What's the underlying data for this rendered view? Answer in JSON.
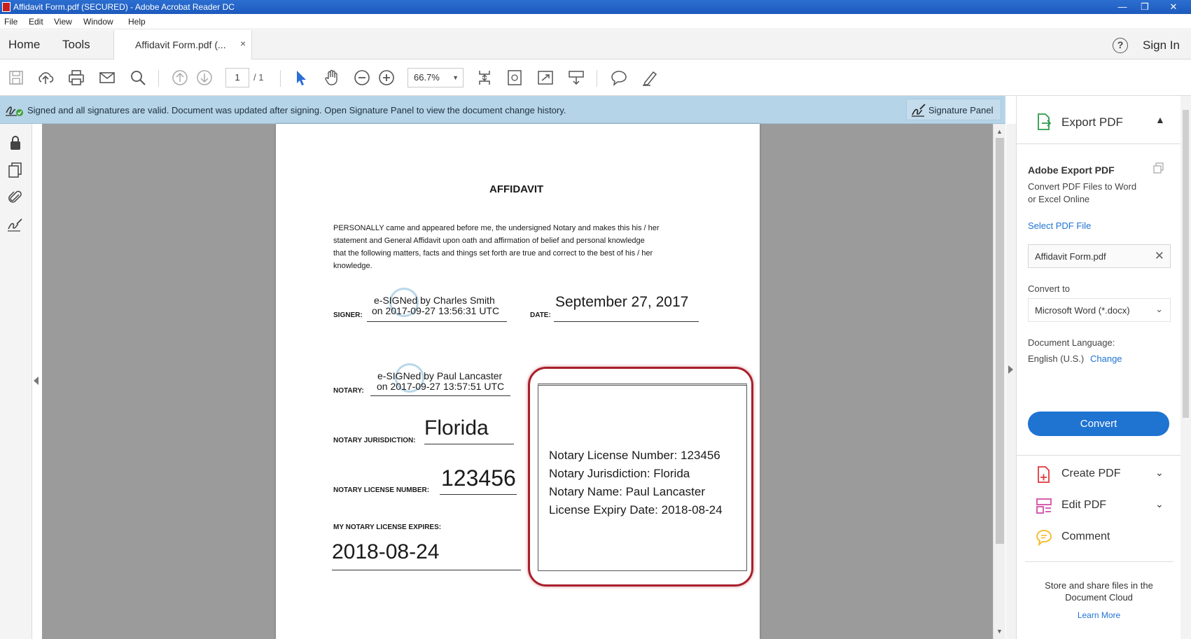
{
  "window": {
    "title": "Affidavit Form.pdf (SECURED) - Adobe Acrobat Reader DC",
    "btn_min": "—",
    "btn_max": "❐",
    "btn_close": "✕"
  },
  "menu": [
    "File",
    "Edit",
    "View",
    "Window",
    "Help"
  ],
  "tabs": {
    "home": "Home",
    "tools": "Tools",
    "document": "Affidavit Form.pdf (...",
    "close_glyph": "×"
  },
  "header": {
    "help_glyph": "?",
    "signin": "Sign In"
  },
  "toolbar": {
    "page_current": "1",
    "page_total": "/ 1",
    "zoom": "66.7%",
    "zoom_caret": "▼"
  },
  "signature_bar": {
    "message": "Signed and all signatures are valid. Document was updated after signing. Open Signature Panel to view the document change history.",
    "panel_button": "Signature Panel"
  },
  "document": {
    "title": "AFFIDAVIT",
    "body_lines": [
      "PERSONALLY came and appeared before me, the undersigned Notary and makes this his / her",
      "statement and General Affidavit upon oath and affirmation of belief and personal knowledge",
      "that the following matters, facts and things set forth are true and correct to the best of his / her",
      "knowledge."
    ],
    "signer_label": "SIGNER:",
    "signer_sig_line1": "e-SIGNed by Charles Smith",
    "signer_sig_line2": "on 2017-09-27 13:56:31 UTC",
    "date_label": "DATE:",
    "date_value": "September 27, 2017",
    "notary_label": "NOTARY:",
    "notary_sig_line1": "e-SIGNed by Paul Lancaster",
    "notary_sig_line2": "on 2017-09-27 13:57:51 UTC",
    "jurisdiction_label": "NOTARY JURISDICTION:",
    "jurisdiction_value": "Florida",
    "license_label": "NOTARY LICENSE NUMBER:",
    "license_value": "123456",
    "expires_label": "MY NOTARY LICENSE EXPIRES:",
    "expires_value": "2018-08-24",
    "stamp_lines": [
      "Notary License Number: 123456",
      "Notary Jurisdiction: Florida",
      "Notary Name: Paul Lancaster",
      "License Expiry Date: 2018-08-24"
    ]
  },
  "right_panel": {
    "export_pdf": "Export PDF",
    "adobe_export_title": "Adobe Export PDF",
    "desc_line1": "Convert PDF Files to Word",
    "desc_line2": "or Excel Online",
    "select_file": "Select PDF File",
    "file_value": "Affidavit Form.pdf",
    "clear_glyph": "✕",
    "convert_to_label": "Convert to",
    "convert_to_value": "Microsoft Word (*.docx)",
    "doc_language_label": "Document Language:",
    "doc_language_value": "English (U.S.)",
    "change_link": "Change",
    "convert_button": "Convert",
    "create_pdf": "Create PDF",
    "edit_pdf": "Edit PDF",
    "comment": "Comment",
    "cloud_line1": "Store and share files in the",
    "cloud_line2": "Document Cloud",
    "learn_more": "Learn More"
  },
  "colors": {
    "accent": "#1f73d1",
    "signature_bar": "#b6d4e8",
    "highlight": "#a8202a"
  }
}
